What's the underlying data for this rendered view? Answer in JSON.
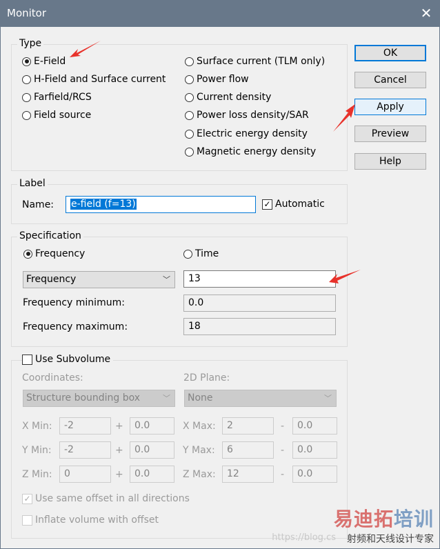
{
  "window": {
    "title": "Monitor",
    "close_icon": "close-icon"
  },
  "type_group": {
    "title": "Type",
    "left_options": [
      {
        "label": "E-Field",
        "selected": true
      },
      {
        "label": "H-Field and Surface current",
        "selected": false
      },
      {
        "label": "Farfield/RCS",
        "selected": false
      },
      {
        "label": "Field source",
        "selected": false
      }
    ],
    "right_options": [
      {
        "label": "Surface current (TLM only)",
        "selected": false
      },
      {
        "label": "Power flow",
        "selected": false
      },
      {
        "label": "Current density",
        "selected": false
      },
      {
        "label": "Power loss density/SAR",
        "selected": false
      },
      {
        "label": "Electric energy density",
        "selected": false
      },
      {
        "label": "Magnetic energy density",
        "selected": false
      }
    ]
  },
  "buttons": {
    "ok": "OK",
    "cancel": "Cancel",
    "apply": "Apply",
    "preview": "Preview",
    "help": "Help"
  },
  "label_group": {
    "title": "Label",
    "name_label": "Name:",
    "name_value": "e-field (f=13)",
    "automatic_label": "Automatic",
    "automatic_checked": true
  },
  "specification": {
    "title": "Specification",
    "frequency_radio": "Frequency",
    "frequency_selected": true,
    "time_radio": "Time",
    "dropdown_value": "Frequency",
    "value": "13",
    "freq_min_label": "Frequency minimum:",
    "freq_min_value": "0.0",
    "freq_max_label": "Frequency maximum:",
    "freq_max_value": "18"
  },
  "subvolume": {
    "title": "Use Subvolume",
    "checked": false,
    "coordinates_label": "Coordinates:",
    "coordinates_value": "Structure bounding box",
    "plane_label": "2D Plane:",
    "plane_value": "None",
    "rows": [
      {
        "min_label": "X Min:",
        "min": "-2",
        "min_off": "0.0",
        "plus": "+",
        "max_label": "X Max:",
        "max": "2",
        "minus": "-",
        "max_off": "0.0"
      },
      {
        "min_label": "Y Min:",
        "min": "-2",
        "min_off": "0.0",
        "plus": "+",
        "max_label": "Y Max:",
        "max": "6",
        "minus": "-",
        "max_off": "0.0"
      },
      {
        "min_label": "Z Min:",
        "min": "0",
        "min_off": "0.0",
        "plus": "+",
        "max_label": "Z Max:",
        "max": "12",
        "minus": "-",
        "max_off": "0.0"
      }
    ],
    "same_offset_label": "Use same offset in all directions",
    "same_offset_checked": true,
    "inflate_label": "Inflate volume with offset",
    "inflate_checked": false
  },
  "watermark": {
    "brand_part1": "易迪拓",
    "brand_part2": "培训",
    "tagline": "射频和天线设计专家",
    "url": "https://blog.cs",
    "color1": "#d9716f",
    "color2": "#7f9fc4"
  },
  "colors": {
    "accent": "#0078d7",
    "annotation_arrow": "#e8322b",
    "titlebar": "#68788a"
  }
}
